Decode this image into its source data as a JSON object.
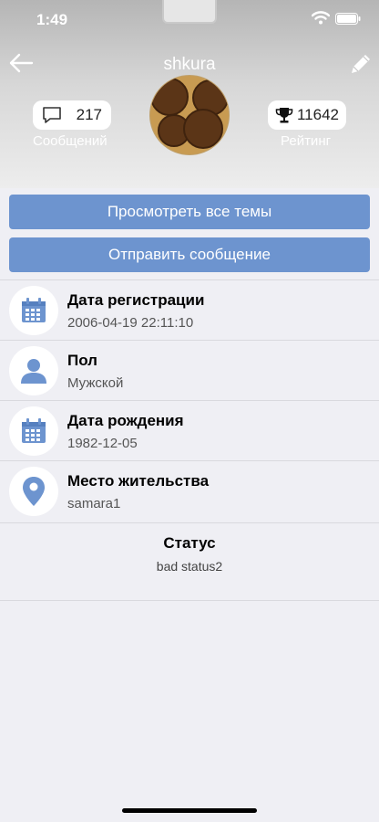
{
  "status_bar": {
    "time": "1:49"
  },
  "profile": {
    "username": "shkura",
    "messages_count": "217",
    "messages_label": "Сообщений",
    "rating_value": "11642",
    "rating_label": "Рейтинг"
  },
  "actions": {
    "view_topics": "Просмотреть все темы",
    "send_message": "Отправить сообщение"
  },
  "info": [
    {
      "title": "Дата регистрации",
      "value": "2006-04-19 22:11:10",
      "icon": "calendar-icon"
    },
    {
      "title": "Пол",
      "value": "Мужской",
      "icon": "person-icon"
    },
    {
      "title": "Дата рождения",
      "value": "1982-12-05",
      "icon": "calendar-icon"
    },
    {
      "title": "Место жительства",
      "value": "samara1",
      "icon": "location-pin-icon"
    }
  ],
  "status": {
    "title": "Статус",
    "value": "bad status2"
  },
  "colors": {
    "accent": "#6d94cf",
    "background": "#efeff4",
    "icon_blue": "#6d94cf"
  }
}
